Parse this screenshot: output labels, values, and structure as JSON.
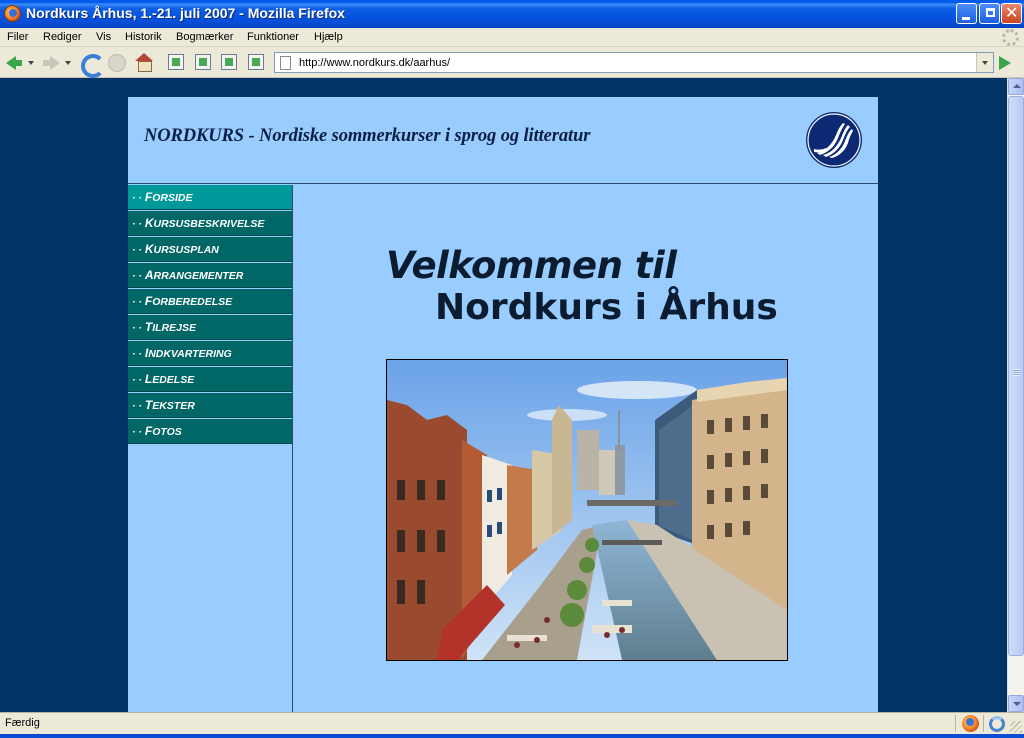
{
  "window": {
    "title": "Nordkurs Århus, 1.-21. juli 2007 - Mozilla Firefox"
  },
  "menu": {
    "items": [
      "Filer",
      "Rediger",
      "Vis",
      "Historik",
      "Bogmærker",
      "Funktioner",
      "Hjælp"
    ]
  },
  "toolbar": {
    "url": "http://www.nordkurs.dk/aarhus/"
  },
  "page": {
    "site_title": "NORDKURS - Nordiske sommerkurser i sprog og litteratur",
    "nav_prefix": "· ·",
    "nav": [
      {
        "first": "F",
        "rest": "orside"
      },
      {
        "first": "K",
        "rest": "ursusbeskrivelse"
      },
      {
        "first": "K",
        "rest": "ursusplan"
      },
      {
        "first": "A",
        "rest": "rrangementer"
      },
      {
        "first": "F",
        "rest": "orberedelse"
      },
      {
        "first": "T",
        "rest": "ilrejse"
      },
      {
        "first": "I",
        "rest": "ndkvartering"
      },
      {
        "first": "L",
        "rest": "edelse"
      },
      {
        "first": "T",
        "rest": "ekster"
      },
      {
        "first": "F",
        "rest": "otos"
      }
    ],
    "active_nav": 0,
    "welcome_line1": "Velkommen til",
    "welcome_line2": "Nordkurs i Århus"
  },
  "statusbar": {
    "text": "Færdig"
  },
  "colors": {
    "page_background": "#003366",
    "content_background": "#99ccff",
    "nav_background": "#006666",
    "nav_active_background": "#009999",
    "titlebar_blue": "#0553e0"
  }
}
